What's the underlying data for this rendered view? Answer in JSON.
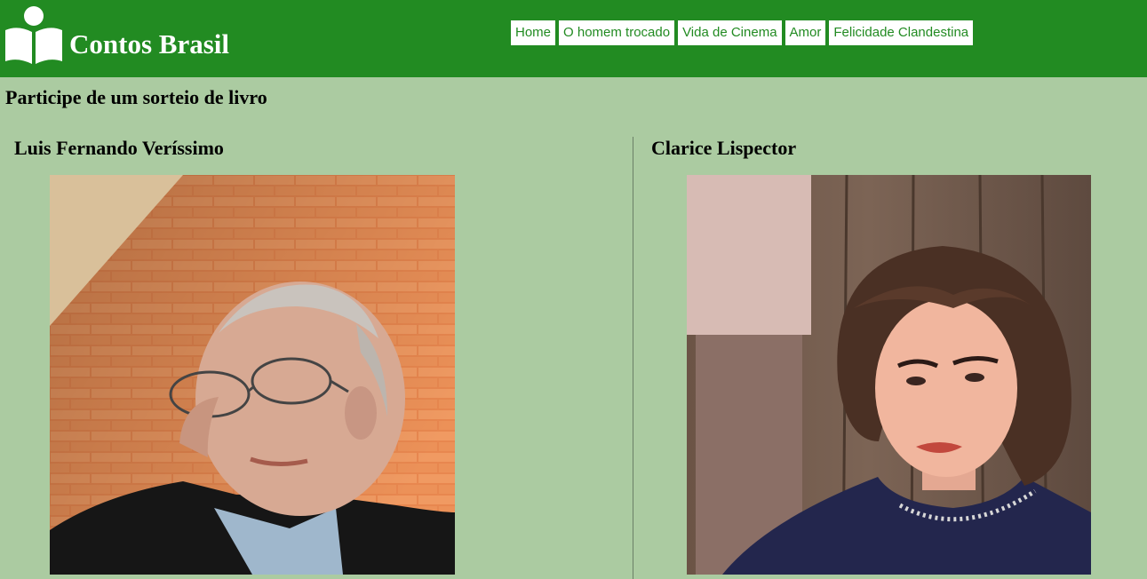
{
  "header": {
    "site_title": "Contos Brasil",
    "logo_icon": "reader-book-icon",
    "nav": [
      {
        "label": "Home"
      },
      {
        "label": "O homem trocado"
      },
      {
        "label": "Vida de Cinema"
      },
      {
        "label": "Amor"
      },
      {
        "label": "Felicidade Clandestina"
      }
    ]
  },
  "main": {
    "heading": "Participe de um sorteio de livro",
    "authors": [
      {
        "name": "Luis Fernando Veríssimo",
        "photo": "portrait-photo"
      },
      {
        "name": "Clarice Lispector",
        "photo": "portrait-photo"
      }
    ]
  },
  "colors": {
    "header_bg": "#228b22",
    "page_bg": "#abcba1",
    "nav_bg": "#ffffff",
    "nav_text": "#228b22"
  }
}
